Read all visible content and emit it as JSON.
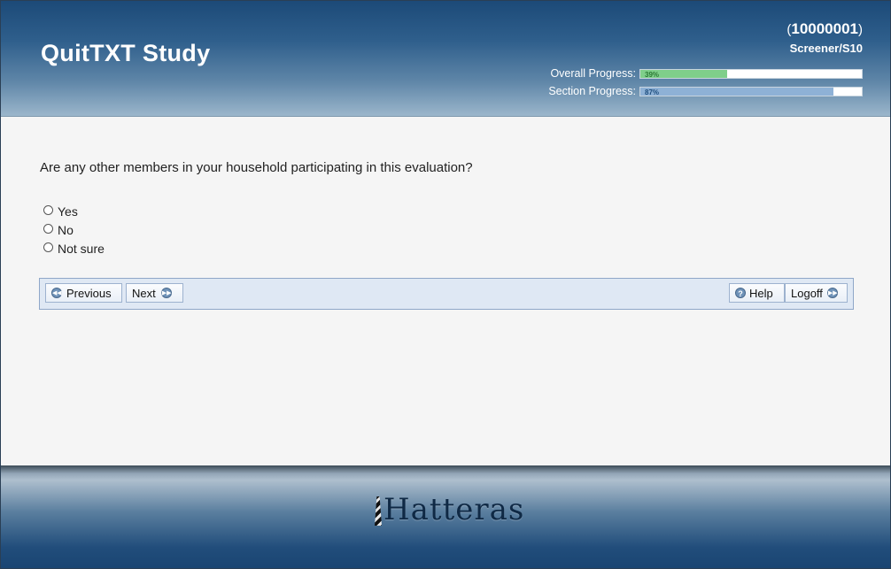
{
  "header": {
    "title": "QuitTXT Study",
    "participant_open": "(",
    "participant_id": "10000001",
    "participant_close": ")",
    "screen_id": "Screener/S10",
    "overall_progress": {
      "label": "Overall Progress:",
      "percent": 39,
      "percent_text": "39%"
    },
    "section_progress": {
      "label": "Section Progress:",
      "percent": 87,
      "percent_text": "87%"
    }
  },
  "question": {
    "text": "Are any other members in your household participating in this evaluation?",
    "options": [
      "Yes",
      "No",
      "Not sure"
    ]
  },
  "nav": {
    "previous_label": "Previous",
    "next_label": "Next",
    "help_label": "Help",
    "logoff_label": "Logoff"
  },
  "footer": {
    "logo_text": "Hatteras"
  },
  "colors": {
    "header_top": "#1c4a78",
    "overall_bar": "#7fcf8a",
    "section_bar": "#8eb1d6",
    "nav_background": "#dfe8f4"
  }
}
